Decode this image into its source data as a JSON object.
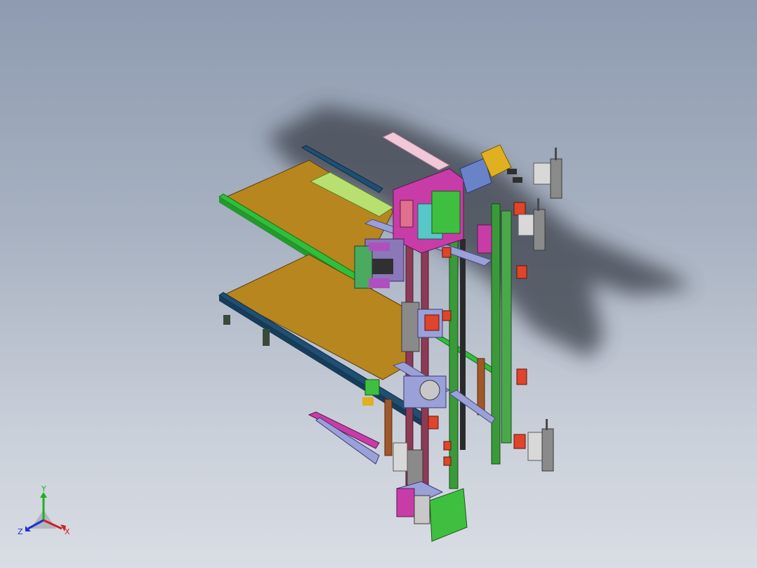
{
  "viewport": {
    "background_top": "#8e9bb0",
    "background_bottom": "#d9dde4"
  },
  "model": {
    "colors": {
      "platform_top": "#b8861e",
      "platform_edge": "#8a5f0e",
      "rail_green": "#2fbf3a",
      "rail_blue": "#1f4f73",
      "frame_purple": "#8a78b8",
      "frame_lavender": "#9aa0d8",
      "post_maroon": "#8c3a55",
      "post_brown": "#a0582a",
      "plate_green": "#3fbf3f",
      "plate_magenta": "#c83ca8",
      "block_red": "#e0442a",
      "block_cyan": "#57c7c7",
      "motor_yellow": "#e0b020",
      "motor_blue": "#6a82c8",
      "sensor_gray": "#8a8a8a",
      "shadow": "#3a3f48"
    }
  },
  "triad": {
    "x_label": "X",
    "y_label": "Y",
    "z_label": "Z",
    "x_color": "#d02020",
    "y_color": "#20b020",
    "z_color": "#2030d0"
  }
}
